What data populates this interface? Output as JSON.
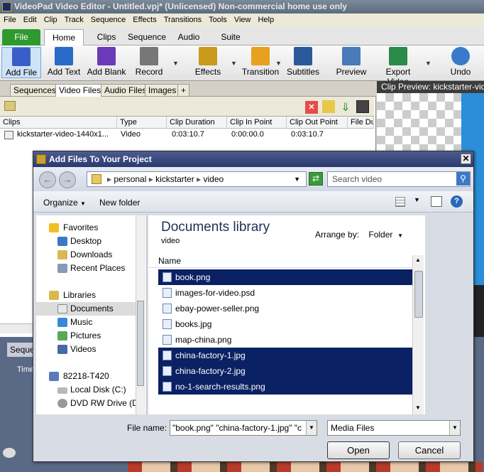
{
  "window": {
    "title": "VideoPad Video Editor - Untitled.vpj* (Unlicensed) Non-commercial home use only"
  },
  "menu": [
    "File",
    "Edit",
    "Clip",
    "Track",
    "Sequence",
    "Effects",
    "Transitions",
    "Tools",
    "View",
    "Help"
  ],
  "ribbon_tabs": {
    "file": "File",
    "home": "Home",
    "clips": "Clips",
    "sequence": "Sequence",
    "audio": "Audio",
    "suite": "Suite"
  },
  "toolbar": {
    "add_file": "Add File",
    "add_text": "Add Text",
    "add_blank": "Add Blank",
    "record": "Record",
    "effects": "Effects",
    "transition": "Transition",
    "subtitles": "Subtitles",
    "preview": "Preview",
    "export_video": "Export Video",
    "undo": "Undo"
  },
  "bin_tabs": {
    "sequences": "Sequences",
    "video_files": "Video Files",
    "audio_files": "Audio Files",
    "images": "Images",
    "add": "+"
  },
  "clip_table": {
    "headers": {
      "clips": "Clips",
      "type": "Type",
      "duration": "Clip Duration",
      "in": "Clip In Point",
      "out": "Clip Out Point",
      "file_dur": "File Du"
    },
    "row": {
      "name": "kickstarter-video-1440x1...",
      "type": "Video",
      "duration": "0:03:10.7",
      "in": "0:00:00.0",
      "out": "0:03:10.7"
    }
  },
  "preview": {
    "title": "Clip Preview: kickstarter-video"
  },
  "sequence_tab": "Seque",
  "time_label": "Time",
  "dialog": {
    "title": "Add Files To Your Project",
    "path": [
      "personal",
      "kickstarter",
      "video"
    ],
    "search_placeholder": "Search video",
    "organize": "Organize",
    "new_folder": "New folder",
    "nav": {
      "favorites": "Favorites",
      "desktop": "Desktop",
      "downloads": "Downloads",
      "recent": "Recent Places",
      "libraries": "Libraries",
      "documents": "Documents",
      "music": "Music",
      "pictures": "Pictures",
      "videos": "Videos",
      "computer": "82218-T420",
      "local_disk": "Local Disk (C:)",
      "dvd": "DVD RW Drive (D:)"
    },
    "library_title": "Documents library",
    "library_sub": "video",
    "arrange_label": "Arrange by:",
    "arrange_value": "Folder",
    "name_col": "Name",
    "files": [
      {
        "name": "book.png",
        "selected": true
      },
      {
        "name": "images-for-video.psd",
        "selected": false
      },
      {
        "name": "ebay-power-seller.png",
        "selected": false
      },
      {
        "name": "books.jpg",
        "selected": false
      },
      {
        "name": "map-china.png",
        "selected": false
      },
      {
        "name": "china-factory-1.jpg",
        "selected": true
      },
      {
        "name": "china-factory-2.jpg",
        "selected": true
      },
      {
        "name": "no-1-search-results.png",
        "selected": true
      }
    ],
    "file_name_label": "File name:",
    "file_name_value": "\"book.png\" \"china-factory-1.jpg\" \"c",
    "file_type": "Media Files",
    "open": "Open",
    "cancel": "Cancel"
  }
}
